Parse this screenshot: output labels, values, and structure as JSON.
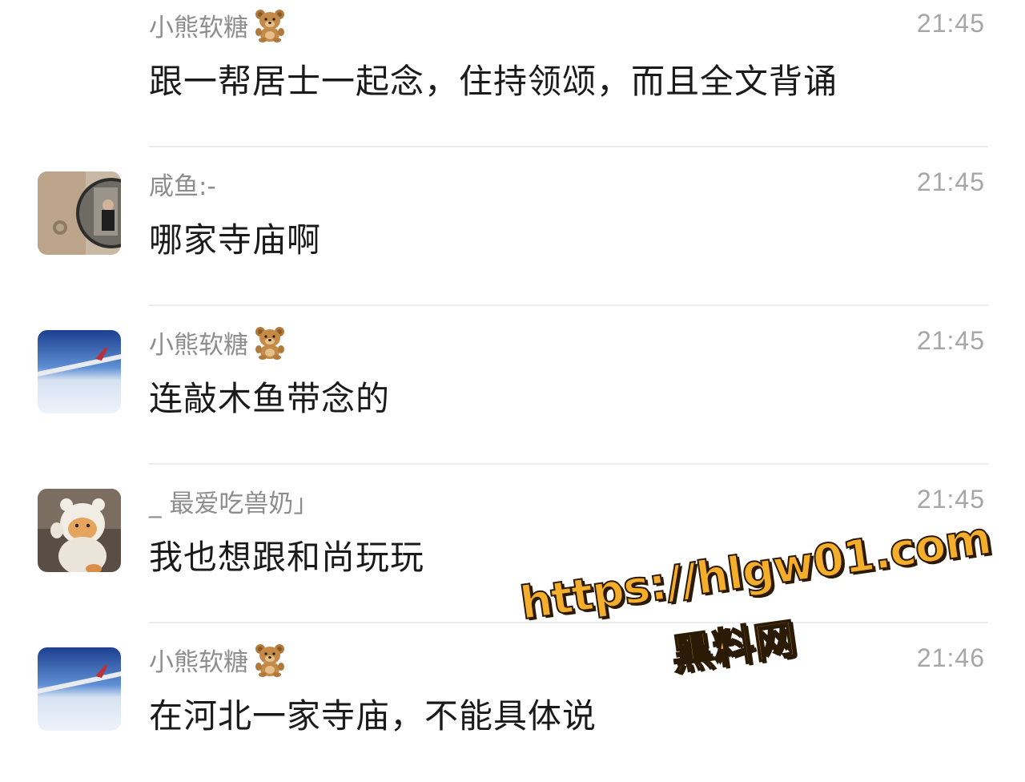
{
  "messages": [
    {
      "sender": "小熊软糖",
      "time": "21:45",
      "text": "跟一帮居士一起念，住持领颂，而且全文背诵",
      "avatar": "none"
    },
    {
      "sender": "咸鱼:-",
      "time": "21:45",
      "text": "哪家寺庙啊",
      "avatar": "mirror-selfie-avatar"
    },
    {
      "sender": "小熊软糖",
      "time": "21:45",
      "text": "连敲木鱼带念的",
      "avatar": "airplane-wing-avatar"
    },
    {
      "sender": "_ 最爱吃兽奶」",
      "time": "21:45",
      "text": "我也想跟和尚玩玩",
      "avatar": "cartoon-bear-avatar"
    },
    {
      "sender": "小熊软糖",
      "time": "21:46",
      "text": "在河北一家寺庙，不能具体说",
      "avatar": "airplane-wing-avatar"
    }
  ],
  "watermark": {
    "url": "https://hlgw01.com",
    "name": "黑料网"
  },
  "colors": {
    "sender_text": "#8d8d8d",
    "time_text": "#a6a6a6",
    "message_text": "#1a1a1a",
    "divider": "#ececec",
    "watermark_fill": "#f5ae2b"
  }
}
